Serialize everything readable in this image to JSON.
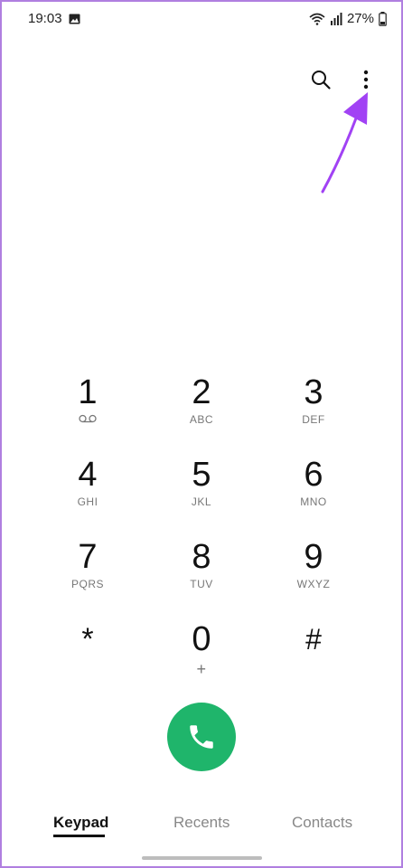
{
  "status_bar": {
    "time": "19:03",
    "battery": "27%"
  },
  "toolbar": {
    "search_icon": "search-icon",
    "more_icon": "more-vertical-icon"
  },
  "keypad": {
    "keys": [
      {
        "digit": "1",
        "sub": "",
        "sub_icon": "voicemail-icon"
      },
      {
        "digit": "2",
        "sub": "ABC"
      },
      {
        "digit": "3",
        "sub": "DEF"
      },
      {
        "digit": "4",
        "sub": "GHI"
      },
      {
        "digit": "5",
        "sub": "JKL"
      },
      {
        "digit": "6",
        "sub": "MNO"
      },
      {
        "digit": "7",
        "sub": "PQRS"
      },
      {
        "digit": "8",
        "sub": "TUV"
      },
      {
        "digit": "9",
        "sub": "WXYZ"
      },
      {
        "digit": "*",
        "sub": ""
      },
      {
        "digit": "0",
        "sub": "+"
      },
      {
        "digit": "#",
        "sub": ""
      }
    ]
  },
  "call": {
    "icon": "phone-icon",
    "color": "#1fb56b"
  },
  "tabs": [
    {
      "label": "Keypad",
      "active": true
    },
    {
      "label": "Recents",
      "active": false
    },
    {
      "label": "Contacts",
      "active": false
    }
  ],
  "annotation": {
    "arrow_color": "#a142f4"
  }
}
